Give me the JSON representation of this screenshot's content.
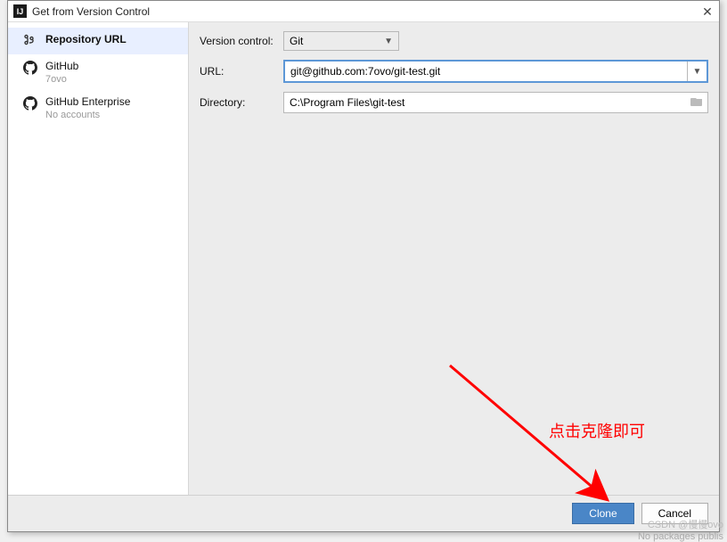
{
  "titlebar": {
    "icon_text": "IJ",
    "title": "Get from Version Control"
  },
  "sidebar": {
    "items": [
      {
        "label": "Repository URL",
        "sub": ""
      },
      {
        "label": "GitHub",
        "sub": "7ovo"
      },
      {
        "label": "GitHub Enterprise",
        "sub": "No accounts"
      }
    ]
  },
  "form": {
    "version_control_label": "Version control:",
    "version_control_value": "Git",
    "url_label": "URL:",
    "url_value": "git@github.com:7ovo/git-test.git",
    "directory_label": "Directory:",
    "directory_value": "C:\\Program Files\\git-test"
  },
  "footer": {
    "clone": "Clone",
    "cancel": "Cancel"
  },
  "annotation": {
    "text": "点击克隆即可"
  },
  "watermark": {
    "line1": "CSDN @慢慢ovo",
    "line2": "No packages publis"
  }
}
